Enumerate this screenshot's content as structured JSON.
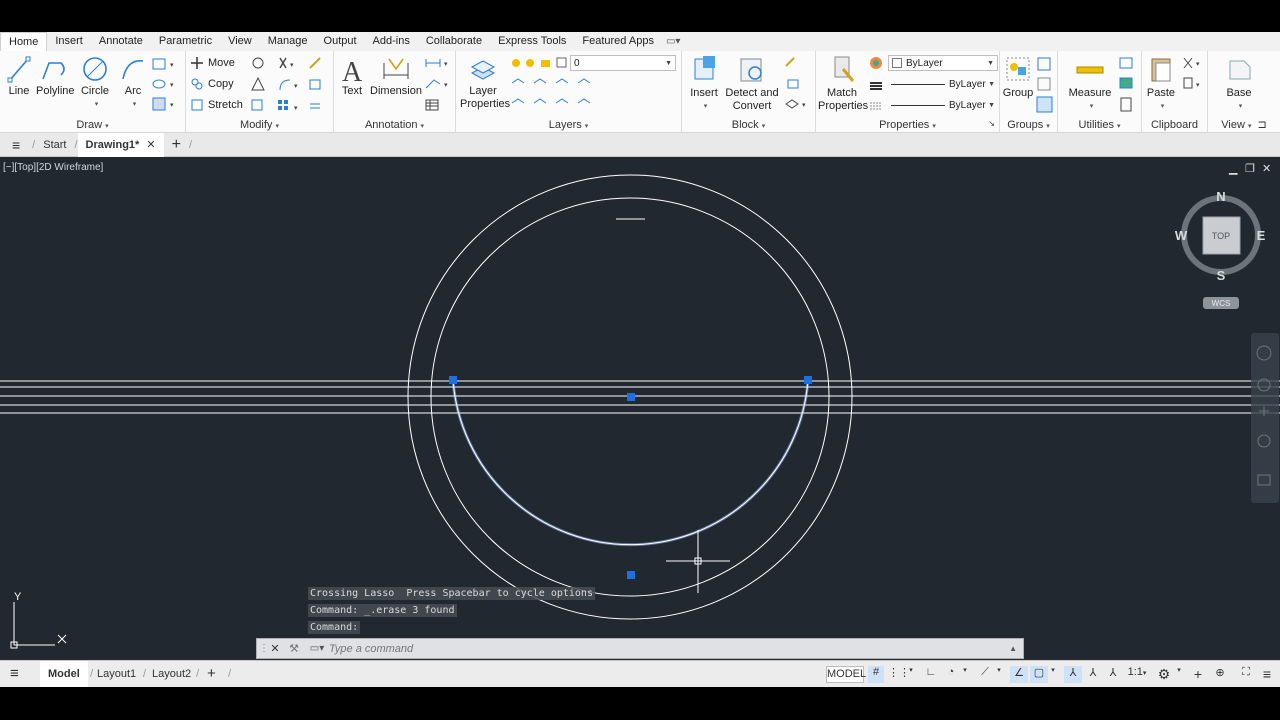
{
  "ribbon_tabs": [
    "Home",
    "Insert",
    "Annotate",
    "Parametric",
    "View",
    "Manage",
    "Output",
    "Add-ins",
    "Collaborate",
    "Express Tools",
    "Featured Apps"
  ],
  "active_tab": "Home",
  "draw": {
    "title": "Draw",
    "line": "Line",
    "polyline": "Polyline",
    "circle": "Circle",
    "arc": "Arc"
  },
  "modify": {
    "title": "Modify",
    "move": "Move",
    "copy": "Copy",
    "stretch": "Stretch"
  },
  "annotation": {
    "title": "Annotation",
    "text": "Text",
    "dimension": "Dimension"
  },
  "layers": {
    "title": "Layers",
    "layer_properties": "Layer Properties",
    "current_layer": "0"
  },
  "block": {
    "title": "Block",
    "insert": "Insert",
    "detect_convert": "Detect and Convert"
  },
  "properties": {
    "title": "Properties",
    "match": "Match Properties",
    "color": "ByLayer",
    "linetype": "ByLayer",
    "lineweight": "ByLayer"
  },
  "groups": {
    "title": "Groups",
    "group": "Group"
  },
  "utilities": {
    "title": "Utilities",
    "measure": "Measure"
  },
  "clipboard": {
    "title": "Clipboard",
    "paste": "Paste"
  },
  "view_panel": {
    "title": "View",
    "base": "Base"
  },
  "file_tabs": {
    "start": "Start",
    "drawing": "Drawing1*"
  },
  "viewport_label": "[−][Top][2D Wireframe]",
  "viewcube": {
    "face": "TOP",
    "n": "N",
    "s": "S",
    "e": "E",
    "w": "W",
    "wcs": "WCS"
  },
  "ucs": {
    "x": "X",
    "y": "Y"
  },
  "command_history": [
    "Crossing Lasso  Press Spacebar to cycle options",
    "Command: _.erase 3 found",
    "Command:"
  ],
  "command_placeholder": "Type a command",
  "layout_tabs": {
    "model": "Model",
    "layout1": "Layout1",
    "layout2": "Layout2"
  },
  "status": {
    "model": "MODEL",
    "scale": "1:1"
  },
  "colors": {
    "canvas": "#212830",
    "selection": "#4a7ff0",
    "grip": "#1e6fe0"
  }
}
